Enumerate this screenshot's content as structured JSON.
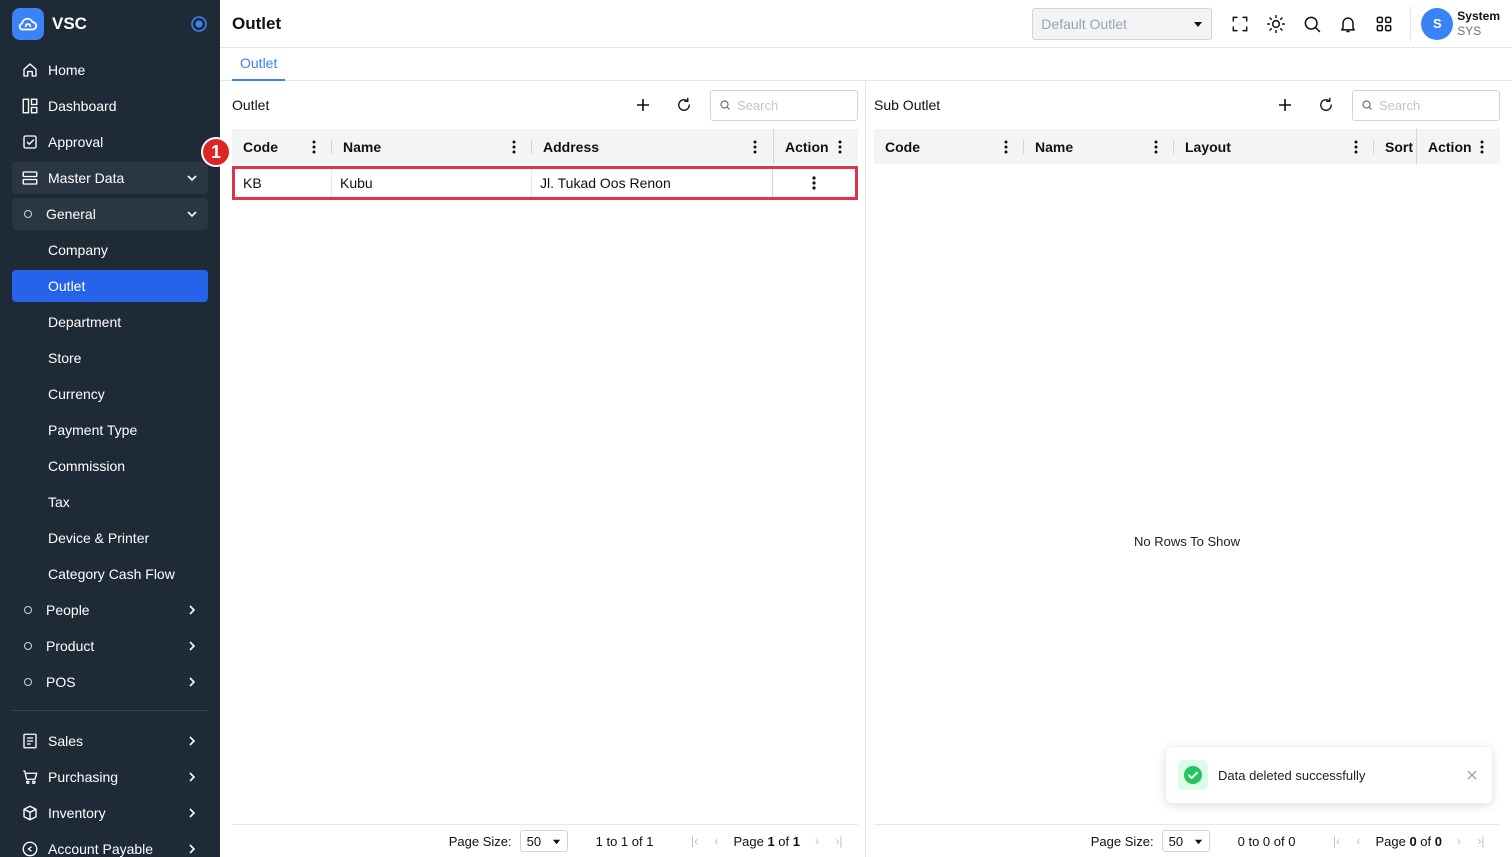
{
  "brand": {
    "name": "VSC"
  },
  "sidebar": {
    "items": [
      {
        "label": "Home",
        "icon": "home-icon"
      },
      {
        "label": "Dashboard",
        "icon": "dashboard-icon"
      },
      {
        "label": "Approval",
        "icon": "approval-icon"
      },
      {
        "label": "Master Data",
        "icon": "server-icon"
      },
      {
        "label": "General"
      },
      {
        "label": "Company"
      },
      {
        "label": "Outlet"
      },
      {
        "label": "Department"
      },
      {
        "label": "Store"
      },
      {
        "label": "Currency"
      },
      {
        "label": "Payment Type"
      },
      {
        "label": "Commission"
      },
      {
        "label": "Tax"
      },
      {
        "label": "Device & Printer"
      },
      {
        "label": "Category Cash Flow"
      },
      {
        "label": "People"
      },
      {
        "label": "Product"
      },
      {
        "label": "POS"
      },
      {
        "label": "Sales",
        "icon": "sales-icon"
      },
      {
        "label": "Purchasing",
        "icon": "cart-icon"
      },
      {
        "label": "Inventory",
        "icon": "box-icon"
      },
      {
        "label": "Account Payable",
        "icon": "account-payable-icon"
      }
    ]
  },
  "header": {
    "title": "Outlet",
    "outlet_select_placeholder": "Default Outlet",
    "user": {
      "avatar": "S",
      "name": "System",
      "code": "SYS"
    }
  },
  "tabs": [
    {
      "label": "Outlet"
    }
  ],
  "outlet_panel": {
    "title": "Outlet",
    "search_placeholder": "Search",
    "columns": [
      "Code",
      "Name",
      "Address",
      "Action"
    ],
    "rows": [
      {
        "code": "KB",
        "name": "Kubu",
        "address": "Jl. Tukad Oos Renon"
      }
    ],
    "annotation": "1",
    "pager": {
      "page_size_label": "Page Size:",
      "page_size": "50",
      "range": "1 to 1 of 1",
      "page_prefix": "Page",
      "page": "1",
      "of": "of",
      "total": "1"
    }
  },
  "sub_outlet_panel": {
    "title": "Sub Outlet",
    "search_placeholder": "Search",
    "columns": [
      "Code",
      "Name",
      "Layout",
      "Sort",
      "Action"
    ],
    "empty_text": "No Rows To Show",
    "pager": {
      "page_size_label": "Page Size:",
      "page_size": "50",
      "range": "0 to 0 of 0",
      "page_prefix": "Page",
      "page": "0",
      "of": "of",
      "total": "0"
    }
  },
  "toast": {
    "message": "Data deleted successfully"
  },
  "colors": {
    "sidebar_bg": "#1f2a37",
    "accent": "#2563eb",
    "highlight": "#dc3545",
    "success": "#22c55e"
  }
}
